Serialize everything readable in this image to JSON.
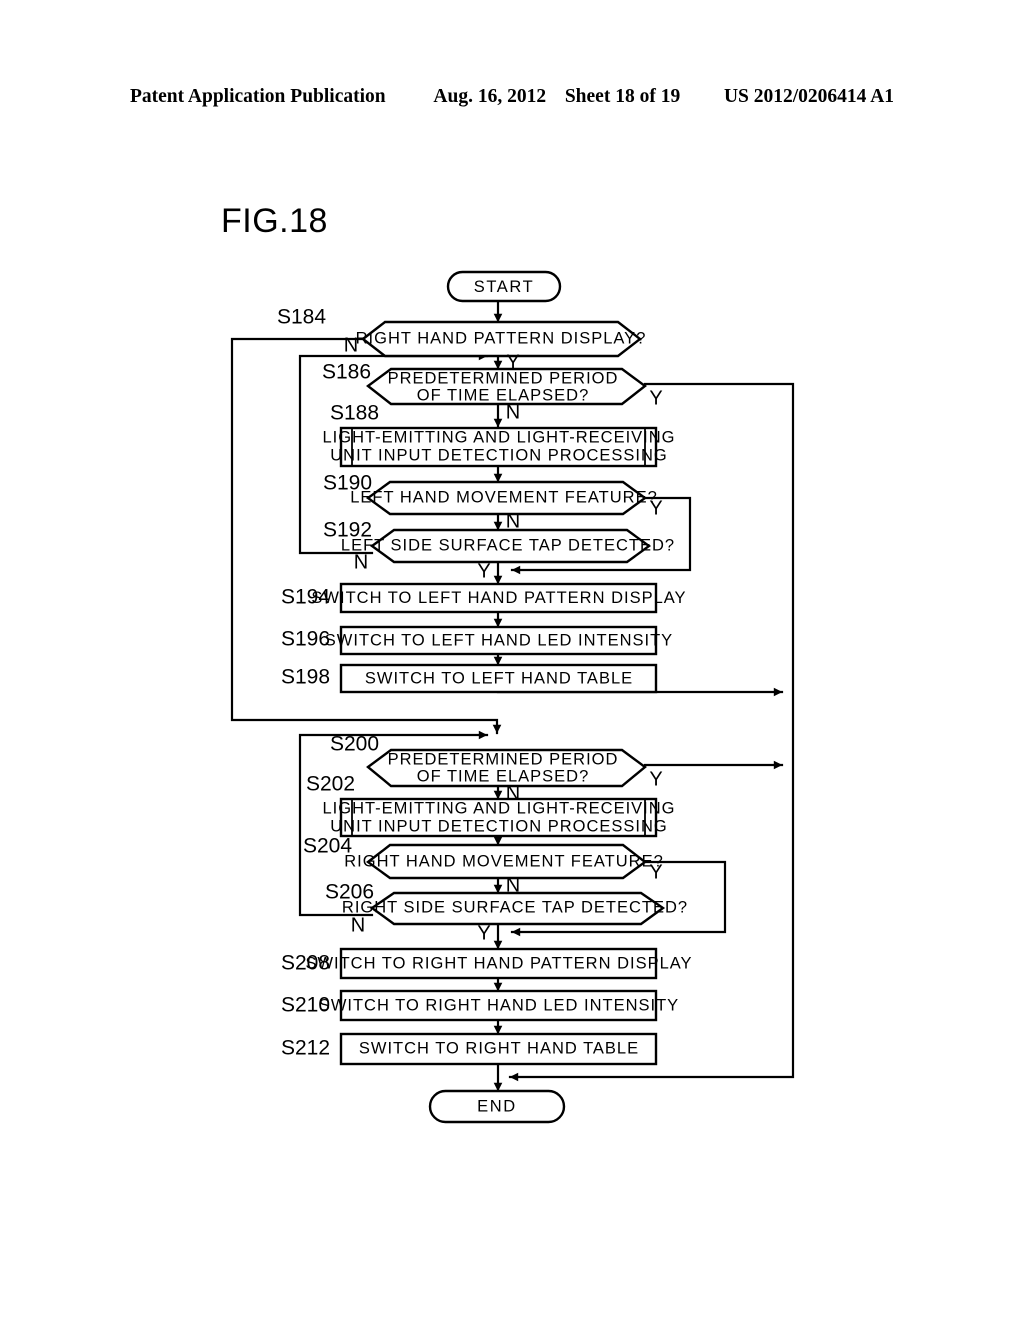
{
  "header": {
    "publication": "Patent Application Publication",
    "date": "Aug. 16, 2012",
    "sheet": "Sheet 18 of 19",
    "patent_number": "US 2012/0206414 A1"
  },
  "figure": {
    "label": "FIG.18"
  },
  "chart_data": {
    "type": "diagram",
    "diagram_type": "flowchart",
    "title": "FIG.18",
    "terminals": [
      {
        "id": "start",
        "label": "START"
      },
      {
        "id": "end",
        "label": "END"
      }
    ],
    "nodes": [
      {
        "step": "S184",
        "shape": "decision",
        "label": "RIGHT HAND PATTERN DISPLAY?",
        "yes": "S186",
        "no": "S200"
      },
      {
        "step": "S186",
        "shape": "decision",
        "label_line1": "PREDETERMINED PERIOD",
        "label_line2": "OF TIME ELAPSED?",
        "yes": "END",
        "no": "S188"
      },
      {
        "step": "S188",
        "shape": "predefined-process",
        "label_line1": "LIGHT-EMITTING AND LIGHT-RECEIVING",
        "label_line2": "UNIT INPUT DETECTION PROCESSING",
        "next": "S190"
      },
      {
        "step": "S190",
        "shape": "decision",
        "label": "LEFT HAND MOVEMENT FEATURE?",
        "yes": "S194",
        "no": "S192"
      },
      {
        "step": "S192",
        "shape": "decision",
        "label": "LEFT SIDE SURFACE TAP DETECTED?",
        "yes": "S194",
        "no": "S186"
      },
      {
        "step": "S194",
        "shape": "process",
        "label": "SWITCH TO LEFT HAND PATTERN DISPLAY",
        "next": "S196"
      },
      {
        "step": "S196",
        "shape": "process",
        "label": "SWITCH TO LEFT HAND LED INTENSITY",
        "next": "S198"
      },
      {
        "step": "S198",
        "shape": "process",
        "label": "SWITCH TO LEFT HAND TABLE",
        "next": "END"
      },
      {
        "step": "S200",
        "shape": "decision",
        "label_line1": "PREDETERMINED PERIOD",
        "label_line2": "OF TIME ELAPSED?",
        "yes": "END",
        "no": "S202"
      },
      {
        "step": "S202",
        "shape": "predefined-process",
        "label_line1": "LIGHT-EMITTING AND LIGHT-RECEIVING",
        "label_line2": "UNIT INPUT DETECTION PROCESSING",
        "next": "S204"
      },
      {
        "step": "S204",
        "shape": "decision",
        "label": "RIGHT HAND MOVEMENT FEATURE?",
        "yes": "S208",
        "no": "S206"
      },
      {
        "step": "S206",
        "shape": "decision",
        "label": "RIGHT SIDE SURFACE TAP DETECTED?",
        "yes": "S208",
        "no": "S200"
      },
      {
        "step": "S208",
        "shape": "process",
        "label": "SWITCH TO RIGHT HAND PATTERN DISPLAY",
        "next": "S210"
      },
      {
        "step": "S210",
        "shape": "process",
        "label": "SWITCH TO RIGHT HAND LED INTENSITY",
        "next": "S212"
      },
      {
        "step": "S212",
        "shape": "process",
        "label": "SWITCH TO RIGHT HAND TABLE",
        "next": "END"
      }
    ],
    "branch_labels": {
      "s184_n": "N",
      "s184_y": "Y",
      "s186_y": "Y",
      "s186_n": "N",
      "s190_y": "Y",
      "s190_n": "N",
      "s192_n": "N",
      "s192_y": "Y",
      "s200_y": "Y",
      "s200_n": "N",
      "s204_y": "Y",
      "s204_n": "N",
      "s206_n": "N",
      "s206_y": "Y"
    },
    "colors": {
      "ink": "#000000",
      "paper": "#ffffff"
    }
  }
}
